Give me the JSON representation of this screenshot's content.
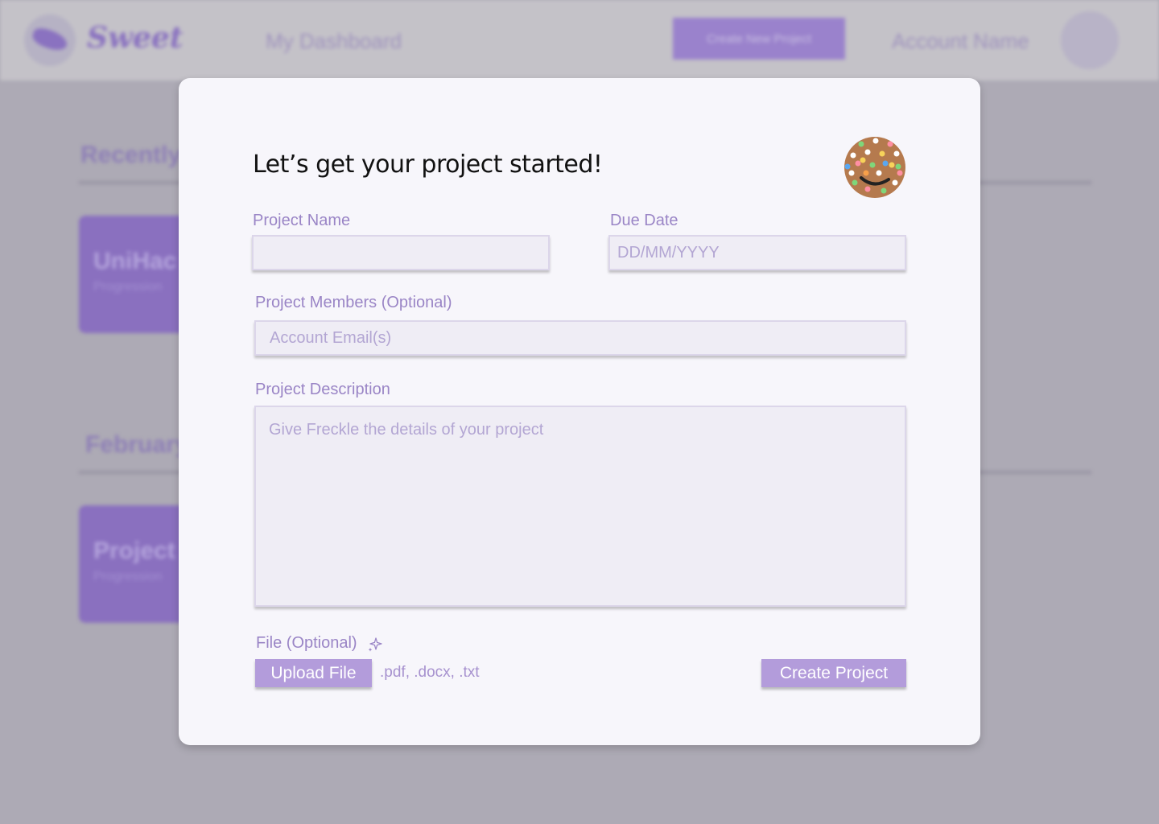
{
  "app": {
    "logo_text": "Sweet",
    "nav_dashboard": "My Dashboard",
    "create_new_label": "Create New Project",
    "account_name": "Account Name"
  },
  "background": {
    "sections": [
      {
        "title": "Recently",
        "card_title": "UniHac",
        "card_sub": "Progression"
      },
      {
        "title": "February",
        "card_title": "Project",
        "card_sub": "Progression"
      }
    ]
  },
  "modal": {
    "title": "Let’s get your project started!",
    "mascot_icon": "cookie-mascot-icon",
    "project_name": {
      "label": "Project Name",
      "value": "",
      "placeholder": ""
    },
    "due_date": {
      "label": "Due Date",
      "value": "",
      "placeholder": "DD/MM/YYYY"
    },
    "members": {
      "label": "Project Members (Optional)",
      "value": "",
      "placeholder": "Account Email(s)"
    },
    "description": {
      "label": "Project Description",
      "value": "",
      "placeholder": "Give Freckle the details of your project"
    },
    "file": {
      "label": "File (Optional)",
      "icon": "sparkle-icon",
      "upload_label": "Upload File",
      "accepted": ".pdf, .docx, .txt"
    },
    "submit_label": "Create Project"
  },
  "colors": {
    "accent": "#b39cdb",
    "label": "#9a85c6",
    "overlay": "#adaab5",
    "modal_bg": "#f7f6fb"
  }
}
